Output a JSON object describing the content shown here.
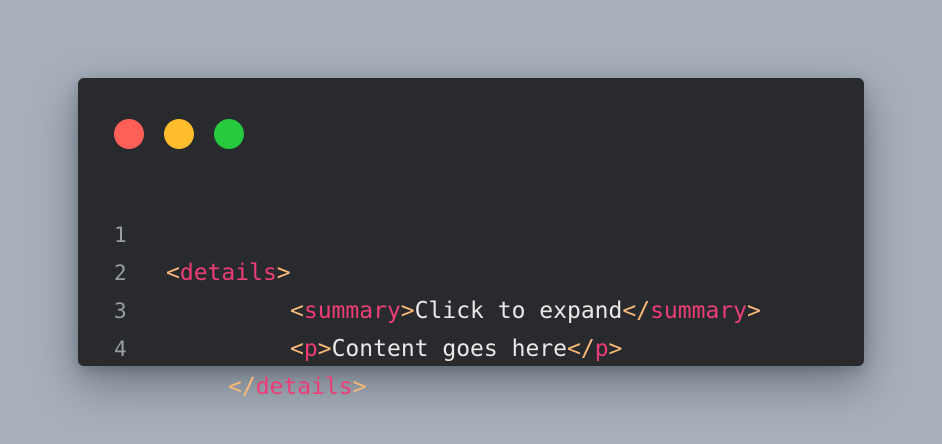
{
  "theme": {
    "background": "#a7b0ba",
    "window_bg": "#282a2d",
    "close_color": "#ff5f56",
    "minimize_color": "#ffbd2e",
    "maximize_color": "#27c93f",
    "tag_color": "#ec3d77",
    "bracket_color": "#f9b878",
    "text_color": "#e8e8e8",
    "line_number_color": "#9a9da1"
  },
  "window_controls": {
    "close": "close-dot",
    "minimize": "minimize-dot",
    "maximize": "maximize-dot"
  },
  "code": {
    "lines": [
      {
        "number": "1",
        "open_bracket": "<",
        "tag": "details",
        "close_bracket": ">"
      },
      {
        "number": "2",
        "open_bracket": "<",
        "tag": "summary",
        "close_bracket": ">",
        "text": "Click to expand",
        "end_open_bracket": "</",
        "end_tag": "summary",
        "end_close_bracket": ">"
      },
      {
        "number": "3",
        "open_bracket": "<",
        "tag": "p",
        "close_bracket": ">",
        "text": "Content goes here",
        "end_open_bracket": "</",
        "end_tag": "p",
        "end_close_bracket": ">"
      },
      {
        "number": "4",
        "open_bracket": "</",
        "tag": "details",
        "close_bracket": ">"
      }
    ]
  }
}
